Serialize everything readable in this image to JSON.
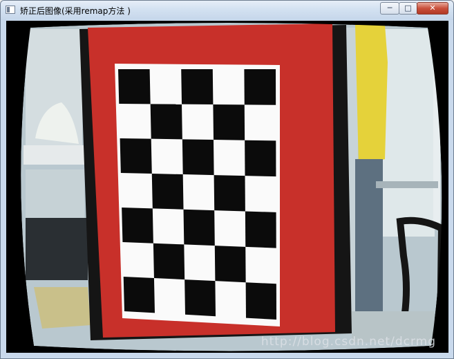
{
  "window": {
    "title": "矫正后图像(采用remap方法 )",
    "controls": {
      "minimize": "─",
      "maximize": "□",
      "close": "✕"
    }
  },
  "image": {
    "watermark": "http://blog.csdn.net/dcrmg",
    "chessboard": {
      "rows": 7,
      "cols": 5
    },
    "colors": {
      "board_frame": "#c8302a",
      "jacket": "#e5d23a",
      "wall": "#cfe0e8"
    }
  }
}
